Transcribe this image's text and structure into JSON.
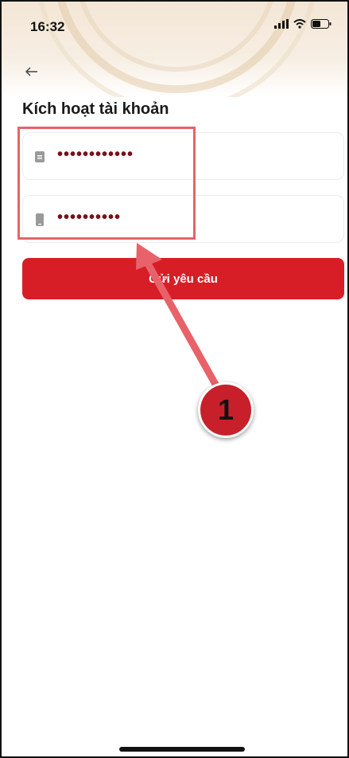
{
  "status_bar": {
    "time": "16:32"
  },
  "header": {
    "title": "Kích hoạt tài khoản"
  },
  "form": {
    "field_1": {
      "value": "••••••••••••"
    },
    "field_2": {
      "value": "••••••••••"
    },
    "submit_label": "Gửi yêu cầu"
  },
  "annotation": {
    "step_number": "1"
  },
  "colors": {
    "accent": "#d71e27",
    "annotation": "#e8626a",
    "masked_text": "#7a0f1c"
  },
  "icons": [
    "back-arrow-icon",
    "signal-icon",
    "wifi-icon",
    "battery-icon",
    "id-card-icon",
    "phone-icon"
  ]
}
